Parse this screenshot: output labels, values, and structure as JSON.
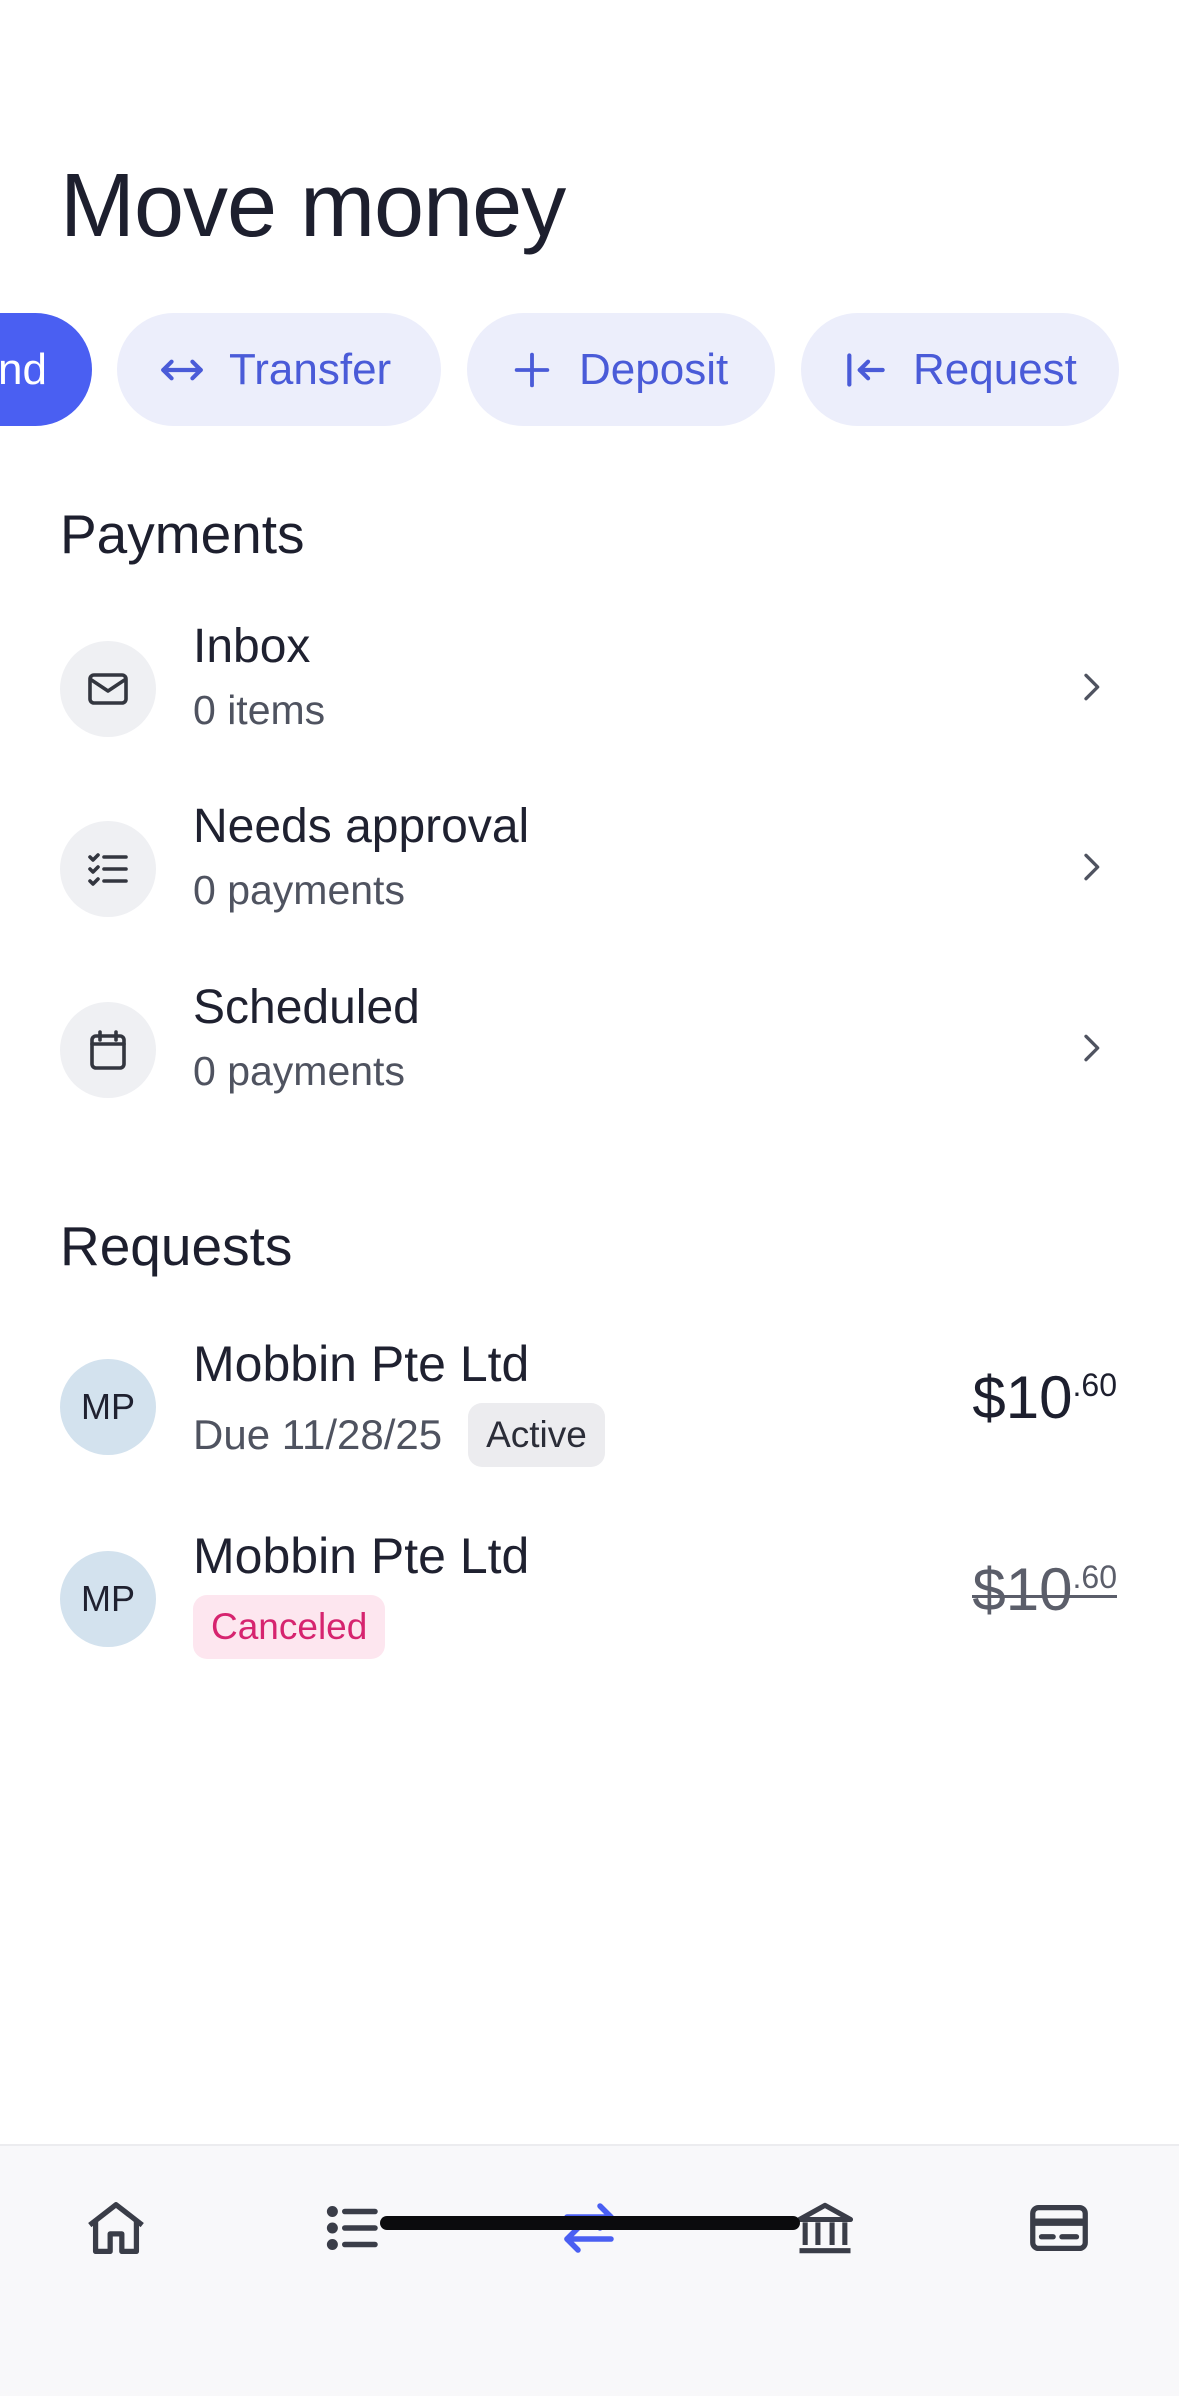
{
  "header": {
    "title": "Move money"
  },
  "actions": {
    "send_label": "Send",
    "transfer_label": "Transfer",
    "deposit_label": "Deposit",
    "request_label": "Request"
  },
  "payments": {
    "title": "Payments",
    "items": [
      {
        "title": "Inbox",
        "subtitle": "0 items",
        "icon": "mail-icon"
      },
      {
        "title": "Needs approval",
        "subtitle": "0 payments",
        "icon": "checklist-icon"
      },
      {
        "title": "Scheduled",
        "subtitle": "0 payments",
        "icon": "calendar-icon"
      }
    ]
  },
  "requests": {
    "title": "Requests",
    "items": [
      {
        "initials": "MP",
        "name": "Mobbin Pte Ltd",
        "due": "Due 11/28/25",
        "status": "Active",
        "amount_whole": "$10",
        "amount_cents": ".60"
      },
      {
        "initials": "MP",
        "name": "Mobbin Pte Ltd",
        "status": "Canceled",
        "amount_whole": "$10",
        "amount_cents": ".60"
      }
    ]
  },
  "tabbar": {
    "items": [
      "home-icon",
      "list-icon",
      "transfer-icon",
      "bank-icon",
      "card-icon"
    ],
    "active": "transfer-icon"
  },
  "colors": {
    "accent": "#4a5ff2",
    "pill_bg": "#eceefb",
    "canceled": "#d6246f"
  }
}
